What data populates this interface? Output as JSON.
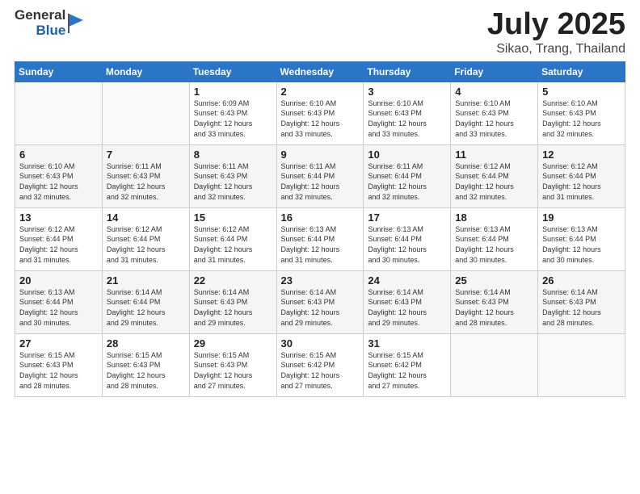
{
  "header": {
    "logo_general": "General",
    "logo_blue": "Blue",
    "title": "July 2025",
    "subtitle": "Sikao, Trang, Thailand"
  },
  "columns": [
    "Sunday",
    "Monday",
    "Tuesday",
    "Wednesday",
    "Thursday",
    "Friday",
    "Saturday"
  ],
  "weeks": [
    [
      {
        "day": "",
        "info": ""
      },
      {
        "day": "",
        "info": ""
      },
      {
        "day": "1",
        "info": "Sunrise: 6:09 AM\nSunset: 6:43 PM\nDaylight: 12 hours\nand 33 minutes."
      },
      {
        "day": "2",
        "info": "Sunrise: 6:10 AM\nSunset: 6:43 PM\nDaylight: 12 hours\nand 33 minutes."
      },
      {
        "day": "3",
        "info": "Sunrise: 6:10 AM\nSunset: 6:43 PM\nDaylight: 12 hours\nand 33 minutes."
      },
      {
        "day": "4",
        "info": "Sunrise: 6:10 AM\nSunset: 6:43 PM\nDaylight: 12 hours\nand 33 minutes."
      },
      {
        "day": "5",
        "info": "Sunrise: 6:10 AM\nSunset: 6:43 PM\nDaylight: 12 hours\nand 32 minutes."
      }
    ],
    [
      {
        "day": "6",
        "info": "Sunrise: 6:10 AM\nSunset: 6:43 PM\nDaylight: 12 hours\nand 32 minutes."
      },
      {
        "day": "7",
        "info": "Sunrise: 6:11 AM\nSunset: 6:43 PM\nDaylight: 12 hours\nand 32 minutes."
      },
      {
        "day": "8",
        "info": "Sunrise: 6:11 AM\nSunset: 6:43 PM\nDaylight: 12 hours\nand 32 minutes."
      },
      {
        "day": "9",
        "info": "Sunrise: 6:11 AM\nSunset: 6:44 PM\nDaylight: 12 hours\nand 32 minutes."
      },
      {
        "day": "10",
        "info": "Sunrise: 6:11 AM\nSunset: 6:44 PM\nDaylight: 12 hours\nand 32 minutes."
      },
      {
        "day": "11",
        "info": "Sunrise: 6:12 AM\nSunset: 6:44 PM\nDaylight: 12 hours\nand 32 minutes."
      },
      {
        "day": "12",
        "info": "Sunrise: 6:12 AM\nSunset: 6:44 PM\nDaylight: 12 hours\nand 31 minutes."
      }
    ],
    [
      {
        "day": "13",
        "info": "Sunrise: 6:12 AM\nSunset: 6:44 PM\nDaylight: 12 hours\nand 31 minutes."
      },
      {
        "day": "14",
        "info": "Sunrise: 6:12 AM\nSunset: 6:44 PM\nDaylight: 12 hours\nand 31 minutes."
      },
      {
        "day": "15",
        "info": "Sunrise: 6:12 AM\nSunset: 6:44 PM\nDaylight: 12 hours\nand 31 minutes."
      },
      {
        "day": "16",
        "info": "Sunrise: 6:13 AM\nSunset: 6:44 PM\nDaylight: 12 hours\nand 31 minutes."
      },
      {
        "day": "17",
        "info": "Sunrise: 6:13 AM\nSunset: 6:44 PM\nDaylight: 12 hours\nand 30 minutes."
      },
      {
        "day": "18",
        "info": "Sunrise: 6:13 AM\nSunset: 6:44 PM\nDaylight: 12 hours\nand 30 minutes."
      },
      {
        "day": "19",
        "info": "Sunrise: 6:13 AM\nSunset: 6:44 PM\nDaylight: 12 hours\nand 30 minutes."
      }
    ],
    [
      {
        "day": "20",
        "info": "Sunrise: 6:13 AM\nSunset: 6:44 PM\nDaylight: 12 hours\nand 30 minutes."
      },
      {
        "day": "21",
        "info": "Sunrise: 6:14 AM\nSunset: 6:44 PM\nDaylight: 12 hours\nand 29 minutes."
      },
      {
        "day": "22",
        "info": "Sunrise: 6:14 AM\nSunset: 6:43 PM\nDaylight: 12 hours\nand 29 minutes."
      },
      {
        "day": "23",
        "info": "Sunrise: 6:14 AM\nSunset: 6:43 PM\nDaylight: 12 hours\nand 29 minutes."
      },
      {
        "day": "24",
        "info": "Sunrise: 6:14 AM\nSunset: 6:43 PM\nDaylight: 12 hours\nand 29 minutes."
      },
      {
        "day": "25",
        "info": "Sunrise: 6:14 AM\nSunset: 6:43 PM\nDaylight: 12 hours\nand 28 minutes."
      },
      {
        "day": "26",
        "info": "Sunrise: 6:14 AM\nSunset: 6:43 PM\nDaylight: 12 hours\nand 28 minutes."
      }
    ],
    [
      {
        "day": "27",
        "info": "Sunrise: 6:15 AM\nSunset: 6:43 PM\nDaylight: 12 hours\nand 28 minutes."
      },
      {
        "day": "28",
        "info": "Sunrise: 6:15 AM\nSunset: 6:43 PM\nDaylight: 12 hours\nand 28 minutes."
      },
      {
        "day": "29",
        "info": "Sunrise: 6:15 AM\nSunset: 6:43 PM\nDaylight: 12 hours\nand 27 minutes."
      },
      {
        "day": "30",
        "info": "Sunrise: 6:15 AM\nSunset: 6:42 PM\nDaylight: 12 hours\nand 27 minutes."
      },
      {
        "day": "31",
        "info": "Sunrise: 6:15 AM\nSunset: 6:42 PM\nDaylight: 12 hours\nand 27 minutes."
      },
      {
        "day": "",
        "info": ""
      },
      {
        "day": "",
        "info": ""
      }
    ]
  ]
}
